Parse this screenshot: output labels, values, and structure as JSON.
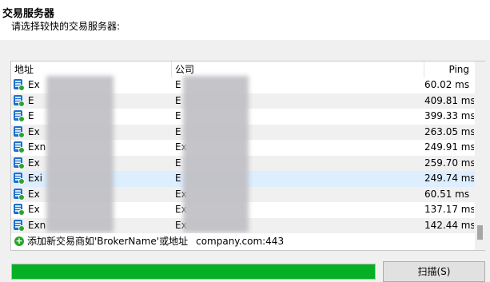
{
  "header": {
    "title": "交易服务器",
    "subtitle": "请选择较快的交易服务器:"
  },
  "table": {
    "columns": [
      "地址",
      "公司",
      "Ping"
    ],
    "rows": [
      {
        "address": "Ex",
        "company": "E",
        "ping": "60.02 ms"
      },
      {
        "address": "E",
        "company": "E",
        "ping": "409.81 ms"
      },
      {
        "address": "E",
        "company": "E",
        "ping": "399.33 ms"
      },
      {
        "address": "Ex",
        "company": "E",
        "ping": "263.05 ms"
      },
      {
        "address": "Exn",
        "company": "Ex",
        "ping": "249.91 ms"
      },
      {
        "address": "Ex",
        "company": "E",
        "ping": "259.70 ms"
      },
      {
        "address": "Exi",
        "company": "E",
        "ping": "249.74 ms"
      },
      {
        "address": "Ex",
        "company": "Ex",
        "ping": "60.51 ms"
      },
      {
        "address": "Ex",
        "company": "Ex",
        "ping": "137.17 ms"
      },
      {
        "address": "Exn",
        "company": "Ex",
        "ping": "142.44 ms"
      }
    ],
    "selected_index": 6,
    "add_hint": "添加新交易商如'BrokerName'或地址",
    "add_hint_tail": "company.com:443"
  },
  "progress": {
    "value": 1.0,
    "color": "#06b025"
  },
  "scan_button": "扫描(S)"
}
